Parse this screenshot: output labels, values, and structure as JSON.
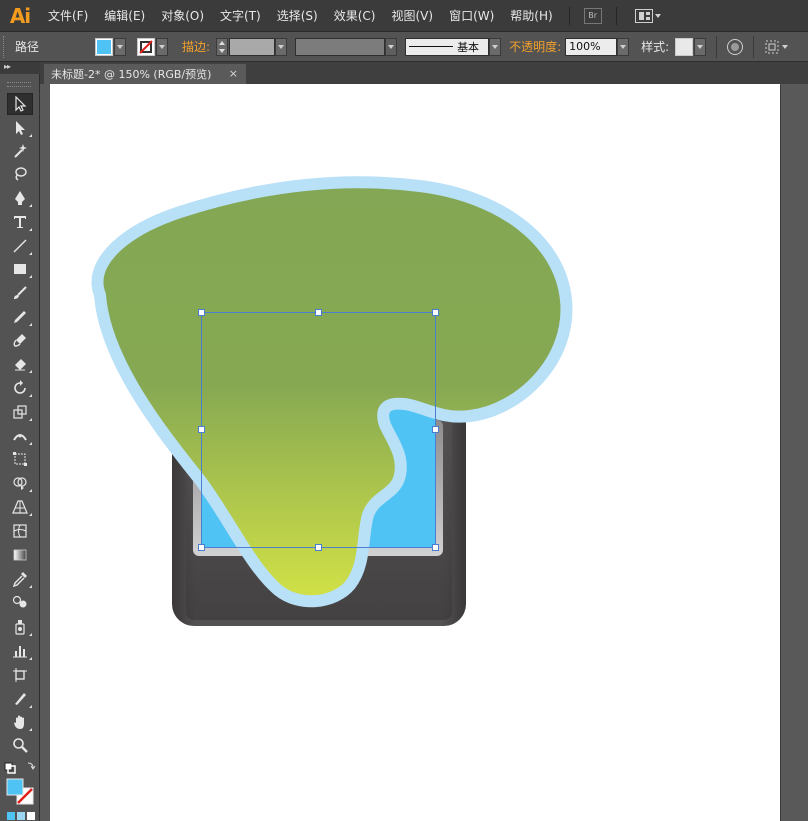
{
  "app": {
    "logo_text": "Ai"
  },
  "menu": {
    "items": [
      "文件(F)",
      "编辑(E)",
      "对象(O)",
      "文字(T)",
      "选择(S)",
      "效果(C)",
      "视图(V)",
      "窗口(W)",
      "帮助(H)"
    ],
    "bridge_label": "Br"
  },
  "control_bar": {
    "selection_type": "路径",
    "stroke_label": "描边:",
    "stroke_profile_label": "基本",
    "opacity_label": "不透明度:",
    "opacity_value": "100%",
    "style_label": "样式:",
    "fill_color": "#4fc3f4"
  },
  "document_tab": {
    "title": "未标题-2* @ 150% (RGB/预览)",
    "close_glyph": "×"
  },
  "toolbar": {
    "collapse_glyph": "▸▸",
    "tools": [
      "selection-tool",
      "direct-selection-tool",
      "magic-wand-tool",
      "lasso-tool",
      "pen-tool",
      "type-tool",
      "line-tool",
      "rectangle-tool",
      "paintbrush-tool",
      "pencil-tool",
      "blob-brush-tool",
      "eraser-tool",
      "rotate-tool",
      "scale-tool",
      "width-tool",
      "free-transform-tool",
      "shape-builder-tool",
      "perspective-grid-tool",
      "mesh-tool",
      "gradient-tool",
      "eyedropper-tool",
      "blend-tool",
      "symbol-sprayer-tool",
      "column-graph-tool",
      "artboard-tool",
      "slice-tool",
      "hand-tool",
      "zoom-tool"
    ]
  },
  "colors": {
    "fill": "#4fc3f4",
    "shape_green_top": "#84a754",
    "shape_green_bottom": "#cfe047",
    "shape_outline": "#b9e0f6",
    "device_dark": "#3f3c3e",
    "screen_blue": "#4fc3f4",
    "selection_blue": "#4a7fd0"
  }
}
